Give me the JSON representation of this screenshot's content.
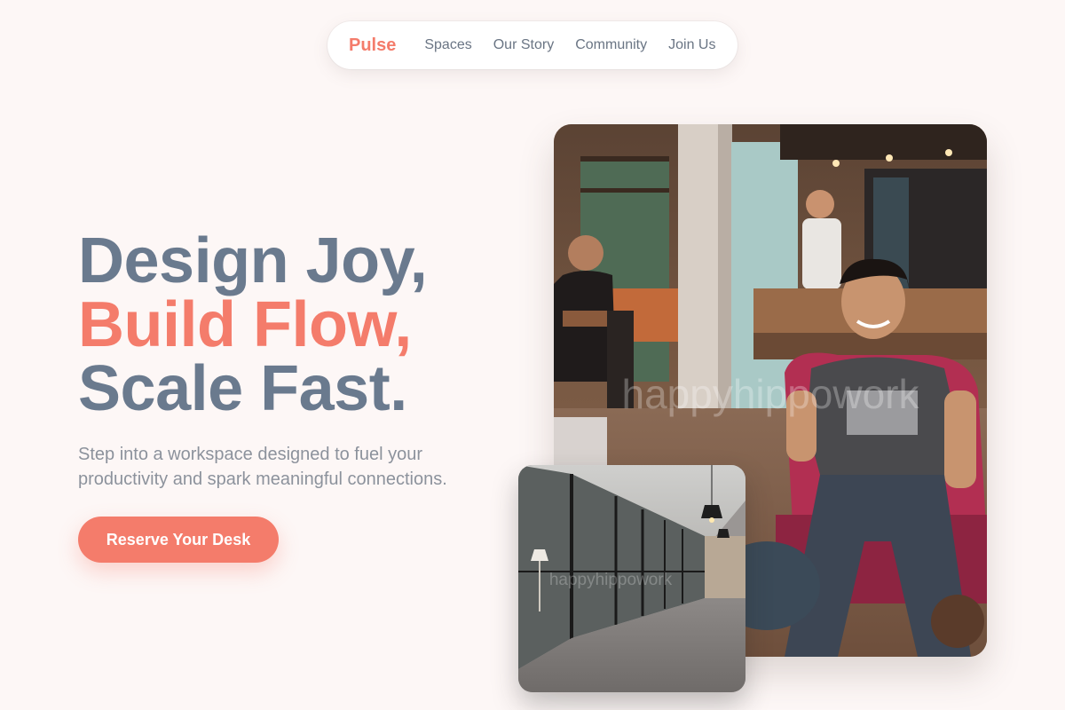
{
  "nav": {
    "brand": "Pulse",
    "links": [
      "Spaces",
      "Our Story",
      "Community",
      "Join Us"
    ]
  },
  "hero": {
    "line1": "Design Joy,",
    "line2": "Build Flow,",
    "line3": "Scale Fast.",
    "subtext": "Step into a workspace designed to fuel your productivity and spark meaningful connections.",
    "cta_label": "Reserve Your Desk"
  },
  "images": {
    "main_watermark": "happyhippowork",
    "secondary_watermark": "happyhippowork"
  },
  "colors": {
    "accent": "#f47c6b",
    "heading": "#6a7a8e",
    "muted": "#8c929c",
    "background": "#fdf7f6"
  }
}
